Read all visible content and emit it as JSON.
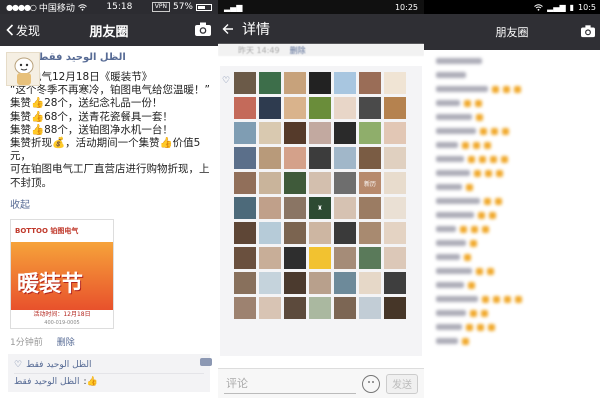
{
  "panel1": {
    "status": {
      "carrier": "中国移动",
      "time": "15:18",
      "vpn": "VPN",
      "battery": "57%",
      "battery_level": 0.57
    },
    "nav": {
      "back_label": "发现",
      "title": "朋友圈"
    },
    "post": {
      "author": "الظل الوحيد فقط",
      "text": "铂图电气12月18日《暖装节》\n“这个冬季不再寒冷，铂图电气给您温暖！”\n集赞👍28个，送纪念礼品一份！\n集赞👍68个，送青花瓷餐具一套！\n集赞👍88个，送铂图净水机一台！\n集赞折现💰，活动期间一个集赞👍价值5元，\n可在铂图电气工厂直营店进行购物折现，上不封顶。",
      "collapse": "收起",
      "poster": {
        "brand": "BOTTOO 铂图电气",
        "headline": "暖装节",
        "date": "活动时间：12月18日",
        "phone": "400-019-0005"
      },
      "time_ago": "1分钟前",
      "delete": "删除"
    },
    "likes": {
      "liker": "الظل الوحيد فقط",
      "commenter": "الظل الوحيد فقط",
      "comment_text": ":👍"
    }
  },
  "panel2": {
    "status": {
      "time": "10:25"
    },
    "nav": {
      "title": "详情"
    },
    "sub": {
      "time": "昨天 14:49",
      "delete": "删除"
    },
    "avatar_colors": [
      "#6b5a48",
      "#3d6e4a",
      "#c7a27b",
      "#222222",
      "#a8c6e0",
      "#9a6d57",
      "#f0e4d4",
      "#c46a5a",
      "#2e3b4f",
      "#d9b38c",
      "#6a8d3a",
      "#e8d6c8",
      "#4a4a4a",
      "#b5824f",
      "#7f9db3",
      "#d9c9b0",
      "#553a2a",
      "#c2a9a0",
      "#2a2a2a",
      "#8fae6b",
      "#e2c7b5",
      "#5b6f8a",
      "#b89a7a",
      "#d4a18a",
      "#3c3c3c",
      "#a1b7c9",
      "#7a5c44",
      "#e0d0c0",
      "#916f5a",
      "#c9b49b",
      "#3f5a3a",
      "#d3bfae",
      "#6e6e6e",
      "#b78a6d",
      "#e8dccd",
      "#4d6a7a",
      "#c0a08a",
      "#8a7564",
      "#2d4a32",
      "#d6c2b2",
      "#9b7c63",
      "#eae0d4",
      "#5e4636",
      "#b6cbd8",
      "#7b6450",
      "#cdb6a2",
      "#3a3a3a",
      "#a88a70",
      "#e4d3c3",
      "#6a503e",
      "#c8ae98",
      "#2e2e2e",
      "#f2c230",
      "#a58c78",
      "#5a7a5a",
      "#dcc8b8",
      "#88705c",
      "#c5d3dc",
      "#4b3a2e",
      "#b8a08c",
      "#6d8a9a",
      "#e6d8c8",
      "#3e3e3e",
      "#9d8270",
      "#d8c4b4",
      "#5c4a3c",
      "#aab8a0",
      "#7c6654",
      "#c2cdd6",
      "#463628"
    ],
    "avatar_labels": {
      "33": "新历",
      "38": "♜"
    },
    "input_placeholder": "评论",
    "send_label": "发送"
  },
  "panel3": {
    "status": {
      "time": "10:5"
    },
    "nav": {
      "title": "朋友圈"
    },
    "rows": [
      {
        "thumbs": 0
      },
      {
        "thumbs": 0
      },
      {
        "thumbs": 3
      },
      {
        "thumbs": 2
      },
      {
        "thumbs": 1
      },
      {
        "thumbs": 3
      },
      {
        "thumbs": 3
      },
      {
        "thumbs": 4
      },
      {
        "thumbs": 3
      },
      {
        "thumbs": 1
      },
      {
        "thumbs": 2
      },
      {
        "thumbs": 2
      },
      {
        "thumbs": 3
      },
      {
        "thumbs": 1
      },
      {
        "thumbs": 1
      },
      {
        "thumbs": 2
      },
      {
        "thumbs": 1
      },
      {
        "thumbs": 4
      },
      {
        "thumbs": 2
      },
      {
        "thumbs": 3
      },
      {
        "thumbs": 1
      }
    ]
  }
}
